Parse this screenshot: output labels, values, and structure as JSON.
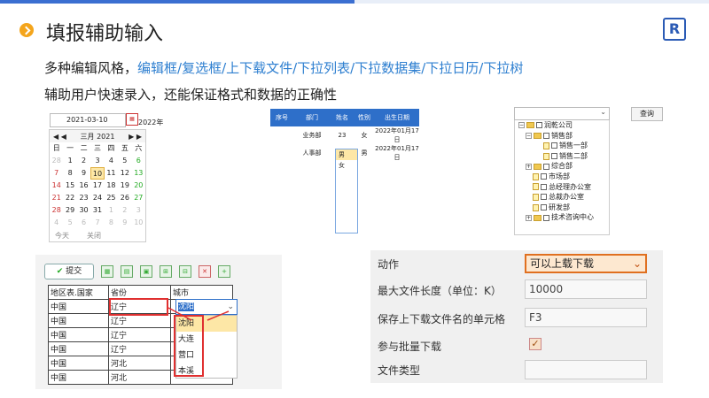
{
  "header": {
    "title": "填报辅助输入",
    "logo_text": "R",
    "line1_prefix": "多种编辑风格，",
    "line1_highlight": "编辑框/复选框/上下载文件/下拉列表/下拉数据集/下拉日历/下拉树",
    "line2": "辅助用户快速录入，还能保证格式和数据的正确性"
  },
  "calendar": {
    "date_value": "2021-03-10",
    "year_suffix": "2022年",
    "month_label": "三月 2021",
    "nav_prev": "◀ ◀",
    "nav_next": "▶ ▶",
    "weekdays": [
      "日",
      "一",
      "二",
      "三",
      "四",
      "五",
      "六"
    ],
    "days": [
      {
        "d": "28",
        "c": "gray"
      },
      {
        "d": "1",
        "c": ""
      },
      {
        "d": "2",
        "c": ""
      },
      {
        "d": "3",
        "c": ""
      },
      {
        "d": "4",
        "c": ""
      },
      {
        "d": "5",
        "c": ""
      },
      {
        "d": "6",
        "c": "green"
      },
      {
        "d": "7",
        "c": "red"
      },
      {
        "d": "8",
        "c": ""
      },
      {
        "d": "9",
        "c": ""
      },
      {
        "d": "10",
        "c": "today"
      },
      {
        "d": "11",
        "c": ""
      },
      {
        "d": "12",
        "c": ""
      },
      {
        "d": "13",
        "c": "green"
      },
      {
        "d": "14",
        "c": "red"
      },
      {
        "d": "15",
        "c": ""
      },
      {
        "d": "16",
        "c": ""
      },
      {
        "d": "17",
        "c": ""
      },
      {
        "d": "18",
        "c": ""
      },
      {
        "d": "19",
        "c": ""
      },
      {
        "d": "20",
        "c": "green"
      },
      {
        "d": "21",
        "c": "red"
      },
      {
        "d": "22",
        "c": ""
      },
      {
        "d": "23",
        "c": ""
      },
      {
        "d": "24",
        "c": ""
      },
      {
        "d": "25",
        "c": ""
      },
      {
        "d": "26",
        "c": ""
      },
      {
        "d": "27",
        "c": "green"
      },
      {
        "d": "28",
        "c": "red"
      },
      {
        "d": "29",
        "c": ""
      },
      {
        "d": "30",
        "c": ""
      },
      {
        "d": "31",
        "c": ""
      },
      {
        "d": "1",
        "c": "gray"
      },
      {
        "d": "2",
        "c": "gray"
      },
      {
        "d": "3",
        "c": "gray"
      },
      {
        "d": "4",
        "c": "gray"
      },
      {
        "d": "5",
        "c": "gray"
      },
      {
        "d": "6",
        "c": "gray"
      },
      {
        "d": "7",
        "c": "gray"
      },
      {
        "d": "8",
        "c": "gray"
      },
      {
        "d": "9",
        "c": "gray"
      },
      {
        "d": "10",
        "c": "gray"
      }
    ],
    "today_btn": "今天",
    "close_btn": "关闭"
  },
  "mid_table": {
    "headers": [
      "序号",
      "部门",
      "姓名",
      "性别",
      "出生日期"
    ],
    "rows": [
      [
        "",
        "业务部",
        "23",
        "女",
        "2022年01月17日"
      ],
      [
        "",
        "人事部",
        "123",
        "男",
        "2022年01月17日"
      ]
    ],
    "dropdown": [
      "男",
      "女"
    ]
  },
  "tree": {
    "query_btn": "查询",
    "items": [
      {
        "label": "润乾公司",
        "type": "root"
      },
      {
        "label": "销售部",
        "type": "folder"
      },
      {
        "label": "销售一部",
        "type": "leaf"
      },
      {
        "label": "销售二部",
        "type": "leaf"
      },
      {
        "label": "综合部",
        "type": "folder2"
      },
      {
        "label": "市场部",
        "type": "leaf2"
      },
      {
        "label": "总经理办公室",
        "type": "leaf2"
      },
      {
        "label": "总裁办公室",
        "type": "leaf2"
      },
      {
        "label": "研发部",
        "type": "leaf2"
      },
      {
        "label": "技术咨询中心",
        "type": "folder2"
      }
    ]
  },
  "grid_editor": {
    "submit": "提交",
    "headers": [
      "地区表.国家",
      "省份",
      "城市"
    ],
    "rows": [
      [
        "中国",
        "辽宁",
        ""
      ],
      [
        "中国",
        "辽宁",
        ""
      ],
      [
        "中国",
        "辽宁",
        ""
      ],
      [
        "中国",
        "辽宁",
        ""
      ],
      [
        "中国",
        "河北",
        ""
      ],
      [
        "中国",
        "河北",
        ""
      ]
    ],
    "selected_city": "沈阳",
    "dropdown": [
      "沈阳",
      "大连",
      "营口",
      "本溪"
    ]
  },
  "form": {
    "action_label": "动作",
    "action_value": "可以上载下载",
    "maxsize_label": "最大文件长度（单位：K）",
    "maxsize_value": "10000",
    "savecell_label": "保存上下载文件名的单元格",
    "savecell_value": "F3",
    "batch_label": "参与批量下载",
    "batch_check": "✓",
    "filetype_label": "文件类型",
    "filetype_value": ""
  }
}
